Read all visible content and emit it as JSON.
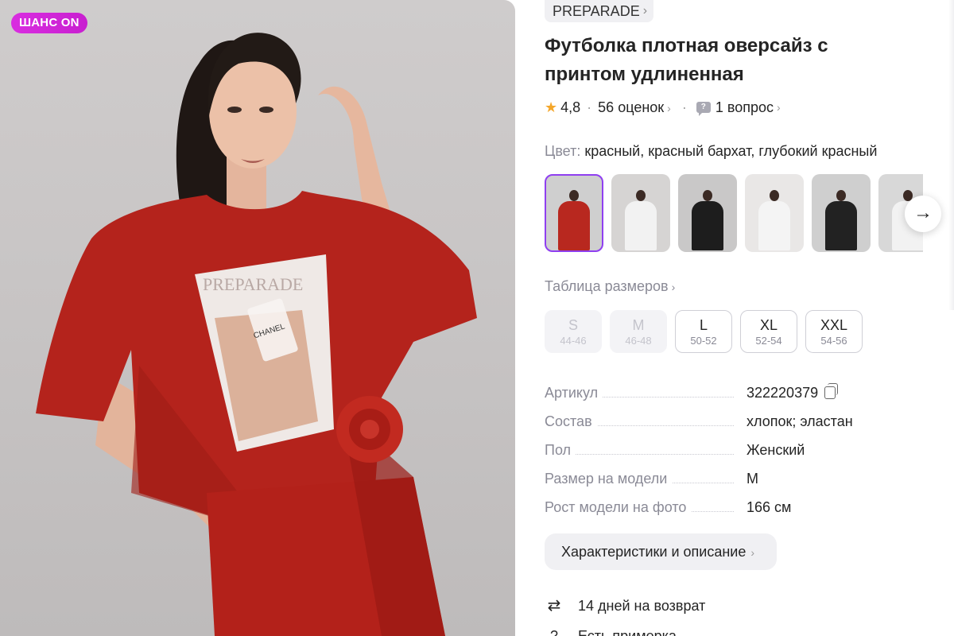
{
  "badge": "ШАНС ON",
  "brand": {
    "name": "PREPARADE",
    "chevron": "›"
  },
  "product": {
    "title": "Футболка плотная оверсайз с принтом удлиненная"
  },
  "rating": {
    "value": "4,8",
    "reviews": "56 оценок",
    "questions": "1 вопрос",
    "star_icon": "star-icon",
    "question_icon": "question-bubble-icon"
  },
  "color": {
    "label": "Цвет:",
    "value": "красный, красный бархат, глубокий красный"
  },
  "swatches": [
    {
      "name": "red",
      "bg": "#cfcfcf",
      "shirt": "#b8281f"
    },
    {
      "name": "white",
      "bg": "#d6d4d3",
      "shirt": "#f2f2f2"
    },
    {
      "name": "black",
      "bg": "#c9c8c8",
      "shirt": "#1d1d1d"
    },
    {
      "name": "white-print",
      "bg": "#e9e7e6",
      "shirt": "#f4f4f4"
    },
    {
      "name": "black-blah",
      "bg": "#cfcfcf",
      "shirt": "#222222"
    },
    {
      "name": "white-blah",
      "bg": "#d8d8d8",
      "shirt": "#f2f2f2"
    }
  ],
  "size_table": {
    "label": "Таблица размеров"
  },
  "sizes": [
    {
      "size": "S",
      "range": "44-46",
      "available": false
    },
    {
      "size": "M",
      "range": "46-48",
      "available": false
    },
    {
      "size": "L",
      "range": "50-52",
      "available": true
    },
    {
      "size": "XL",
      "range": "52-54",
      "available": true
    },
    {
      "size": "XXL",
      "range": "54-56",
      "available": true
    }
  ],
  "params": [
    {
      "key": "Артикул",
      "value": "322220379"
    },
    {
      "key": "Состав",
      "value": "хлопок; эластан"
    },
    {
      "key": "Пол",
      "value": "Женский"
    },
    {
      "key": "Размер на модели",
      "value": "M"
    },
    {
      "key": "Рост модели на фото",
      "value": "166 см"
    }
  ],
  "chars_button": "Характеристики и описание",
  "return": {
    "text": "14 дней на возврат"
  },
  "cut_text": "Есть примерка",
  "colors": {
    "accent": "#8f3ff0",
    "badge": "#d92de0",
    "star": "#f4a62a",
    "muted": "#8a8a96"
  }
}
